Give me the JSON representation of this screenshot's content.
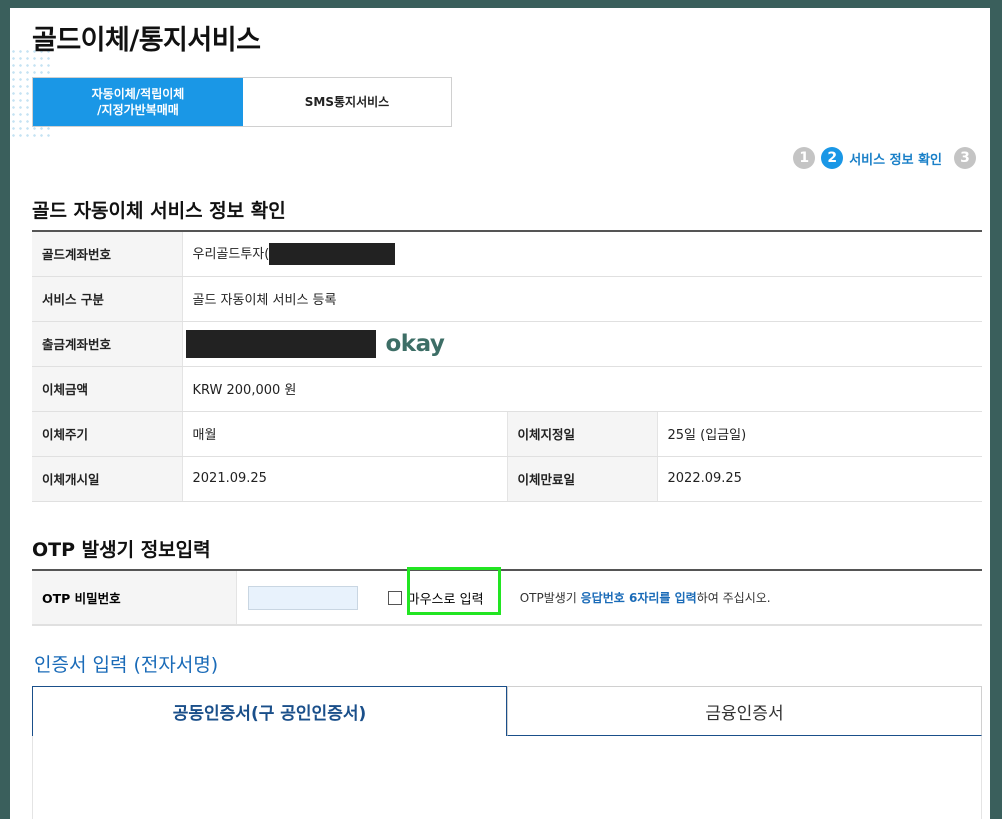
{
  "page_title": "골드이체/통지서비스",
  "tabs": [
    {
      "label": "자동이체/적립이체\n/지정가반복매매",
      "active": true
    },
    {
      "label": "SMS통지서비스",
      "active": false
    }
  ],
  "steps": {
    "items": [
      "1",
      "2",
      "3"
    ],
    "current_label": "서비스 정보 확인",
    "current_index": 2
  },
  "info_section": {
    "title": "골드 자동이체 서비스 정보 확인",
    "rows": {
      "gold_account": {
        "label": "골드계좌번호",
        "value": "우리골드투자("
      },
      "service_type": {
        "label": "서비스 구분",
        "value": "골드 자동이체 서비스 등록"
      },
      "withdraw_account": {
        "label": "출금계좌번호",
        "overlay_text": "okay"
      },
      "amount": {
        "label": "이체금액",
        "value": "KRW 200,000 원"
      },
      "cycle": {
        "label": "이체주기",
        "value": "매월"
      },
      "designated_day": {
        "label": "이체지정일",
        "value": "25일 (입금일)"
      },
      "start_date": {
        "label": "이체개시일",
        "value": "2021.09.25"
      },
      "end_date": {
        "label": "이체만료일",
        "value": "2022.09.25"
      }
    }
  },
  "otp_section": {
    "title": "OTP 발생기 정보입력",
    "label": "OTP 비밀번호",
    "input_value": "",
    "mouse_input_label": "마우스로 입력",
    "mouse_input_checked": false,
    "note_prefix": "OTP발생기 ",
    "note_highlight": "응답번호 6자리를 입력",
    "note_suffix": "하여 주십시오."
  },
  "cert_section": {
    "title": "인증서 입력 (전자서명)",
    "tabs": [
      {
        "label": "공동인증서(구 공인인증서)",
        "active": true
      },
      {
        "label": "금융인증서",
        "active": false
      }
    ]
  },
  "colors": {
    "accent_blue": "#1a97e6",
    "highlight_box": "#22e522",
    "frame": "#3a5f5c"
  }
}
